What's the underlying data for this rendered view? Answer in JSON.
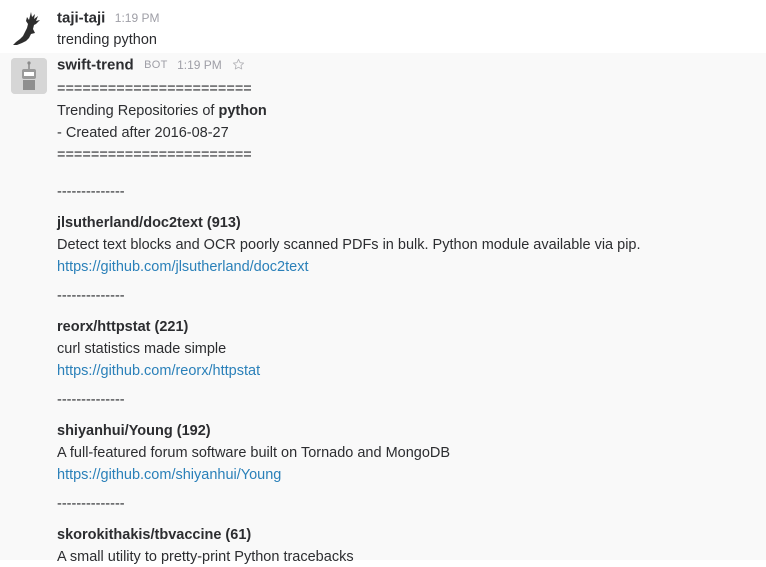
{
  "messages": [
    {
      "username": "taji-taji",
      "time": "1:19 PM",
      "text": "trending python"
    },
    {
      "username": "swift-trend",
      "badge": "BOT",
      "time": "1:19 PM",
      "header": {
        "rule_top": "=======================",
        "title_prefix": "Trending Repositories of ",
        "title_lang": "python",
        "created": "- Created after 2016-08-27",
        "rule_bottom": "======================="
      },
      "separator": "--------------",
      "repos": [
        {
          "name": "jlsutherland/doc2text (913)",
          "description": "Detect text blocks and OCR poorly scanned PDFs in bulk. Python module available via pip.",
          "url": "https://github.com/jlsutherland/doc2text"
        },
        {
          "name": "reorx/httpstat (221)",
          "description": "curl statistics made simple",
          "url": "https://github.com/reorx/httpstat"
        },
        {
          "name": "shiyanhui/Young (192)",
          "description": "A full-featured forum software built on Tornado and MongoDB",
          "url": "https://github.com/shiyanhui/Young"
        },
        {
          "name": "skorokithakis/tbvaccine (61)",
          "description": "A small utility to pretty-print Python tracebacks"
        }
      ]
    }
  ],
  "colors": {
    "link": "#2a80b9",
    "timestamp": "#9e9ea6",
    "text": "#2c2d30",
    "bot_message_bg": "#f9f9f9"
  },
  "icons": {
    "avatar_user": "deer-silhouette-icon",
    "avatar_bot": "robot-icon",
    "star": "star-outline-icon"
  }
}
